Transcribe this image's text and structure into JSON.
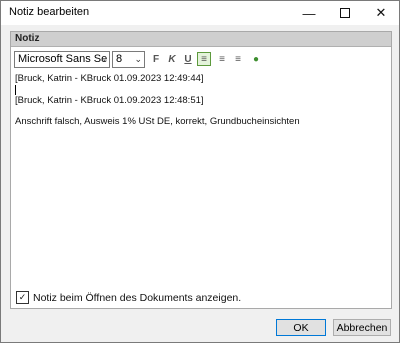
{
  "window": {
    "title": "Notiz bearbeiten",
    "minimize_icon": "minimize-icon",
    "maximize_icon": "maximize-icon",
    "close_icon": "close-icon"
  },
  "panel": {
    "header": "Notiz"
  },
  "toolbar": {
    "font_family": "Microsoft Sans Se",
    "font_size": "8",
    "buttons": [
      {
        "name": "bold-icon",
        "glyph": "F"
      },
      {
        "name": "italic-icon",
        "glyph": "K"
      },
      {
        "name": "underline-icon",
        "glyph": "U"
      },
      {
        "name": "align-left-icon",
        "glyph": "≡"
      },
      {
        "name": "align-center-icon",
        "glyph": "≡"
      },
      {
        "name": "align-right-icon",
        "glyph": "≡"
      },
      {
        "name": "color-icon",
        "glyph": "●"
      }
    ]
  },
  "editor": {
    "lines": [
      "[Bruck, Katrin - KBruck 01.09.2023 12:49:44]",
      "",
      "[Bruck, Katrin - KBruck 01.09.2023 12:48:51]",
      "",
      "Anschrift falsch, Ausweis 1% USt DE, korrekt, Grundbucheinsichten"
    ]
  },
  "checkbox": {
    "label": "Notiz beim Öffnen des Dokuments anzeigen.",
    "checked": true
  },
  "buttons": {
    "ok": "OK",
    "cancel": "Abbrechen"
  }
}
